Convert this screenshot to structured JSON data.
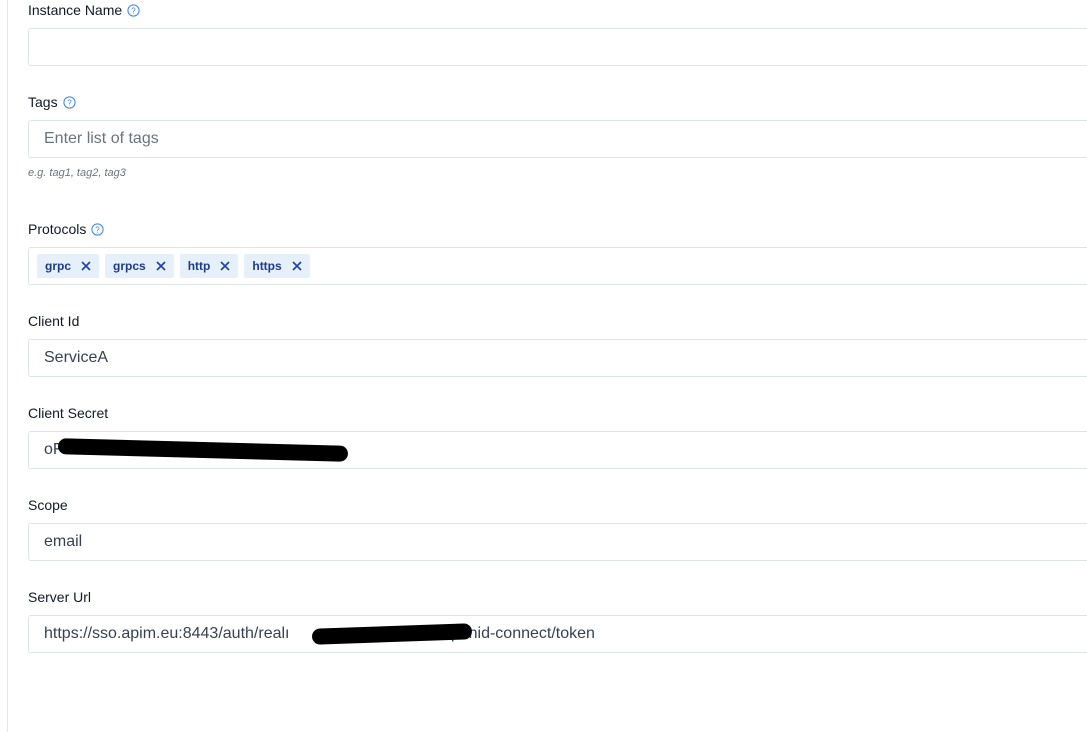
{
  "form": {
    "instance_name": {
      "label": "Instance Name",
      "value": ""
    },
    "tags": {
      "label": "Tags",
      "placeholder": "Enter list of tags",
      "hint": "e.g. tag1, tag2, tag3"
    },
    "protocols": {
      "label": "Protocols",
      "chips": [
        "grpc",
        "grpcs",
        "http",
        "https"
      ]
    },
    "client_id": {
      "label": "Client Id",
      "value": "ServiceA"
    },
    "client_secret": {
      "label": "Client Secret",
      "value": "oF"
    },
    "scope": {
      "label": "Scope",
      "value": "email"
    },
    "server_url": {
      "label": "Server Url",
      "value": "https://sso.apim.eu:8443/auth/realı",
      "value_tail": "/openid-connect/token"
    }
  },
  "colors": {
    "accent": "#3b82f6",
    "chip_bg": "#e6f0fb",
    "chip_text": "#1e3a8a"
  }
}
